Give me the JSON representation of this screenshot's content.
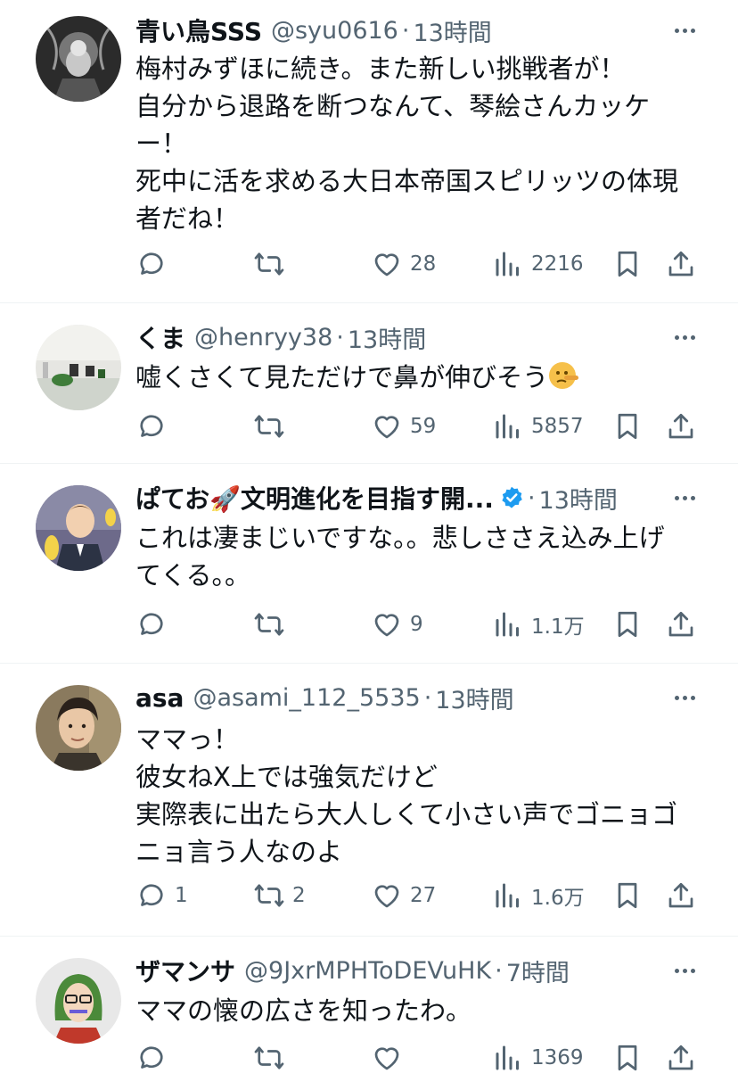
{
  "posts": [
    {
      "name": "青い鳥SSS",
      "handle": "@syu0616",
      "time": "13時間",
      "verified": false,
      "lines": [
        "梅村みずほに続き。また新しい挑戦者が！",
        "自分から退路を断つなんて、琴絵さんカッケ",
        "ー！",
        "死中に活を求める大日本帝国スピリッツの体現",
        "者だね！"
      ],
      "replies": "",
      "reposts": "",
      "likes": "28",
      "views": "2216"
    },
    {
      "name": "くま",
      "handle": "@henryy38",
      "time": "13時間",
      "verified": false,
      "lines": [
        "嘘くさくて見ただけで鼻が伸びそう"
      ],
      "emoji": "lying-face-emoji",
      "replies": "",
      "reposts": "",
      "likes": "59",
      "views": "5857"
    },
    {
      "name": "ぱてお🚀文明進化を目指す開...",
      "handle": "",
      "time": "13時間",
      "verified": true,
      "lines": [
        "これは凄まじいですな。。悲しささえ込み上げ",
        "てくる。。"
      ],
      "replies": "",
      "reposts": "",
      "likes": "9",
      "views": "1.1万"
    },
    {
      "name": "asa",
      "handle": "@asami_112_5535",
      "time": "13時間",
      "verified": false,
      "lines": [
        "ママっ！",
        "彼女ねX上では強気だけど",
        "実際表に出たら大人しくて小さい声でゴニョゴ",
        "ニョ言う人なのよ"
      ],
      "replies": "1",
      "reposts": "2",
      "likes": "27",
      "views": "1.6万"
    },
    {
      "name": "ザマンサ",
      "handle": "@9JxrMPHToDEVuHK",
      "time": "7時間",
      "verified": false,
      "lines": [
        "ママの懐の広さを知ったわ。"
      ],
      "replies": "",
      "reposts": "",
      "likes": "",
      "views": "1369"
    }
  ],
  "icons": {
    "reply": "reply-icon",
    "repost": "repost-icon",
    "like": "like-icon",
    "views": "views-icon",
    "bookmark": "bookmark-icon",
    "share": "share-icon",
    "more": "more-icon",
    "verified": "verified-badge-icon"
  },
  "colors": {
    "text": "#0f1419",
    "muted": "#536471",
    "verified": "#1d9bf0",
    "divider": "#eff3f4"
  }
}
